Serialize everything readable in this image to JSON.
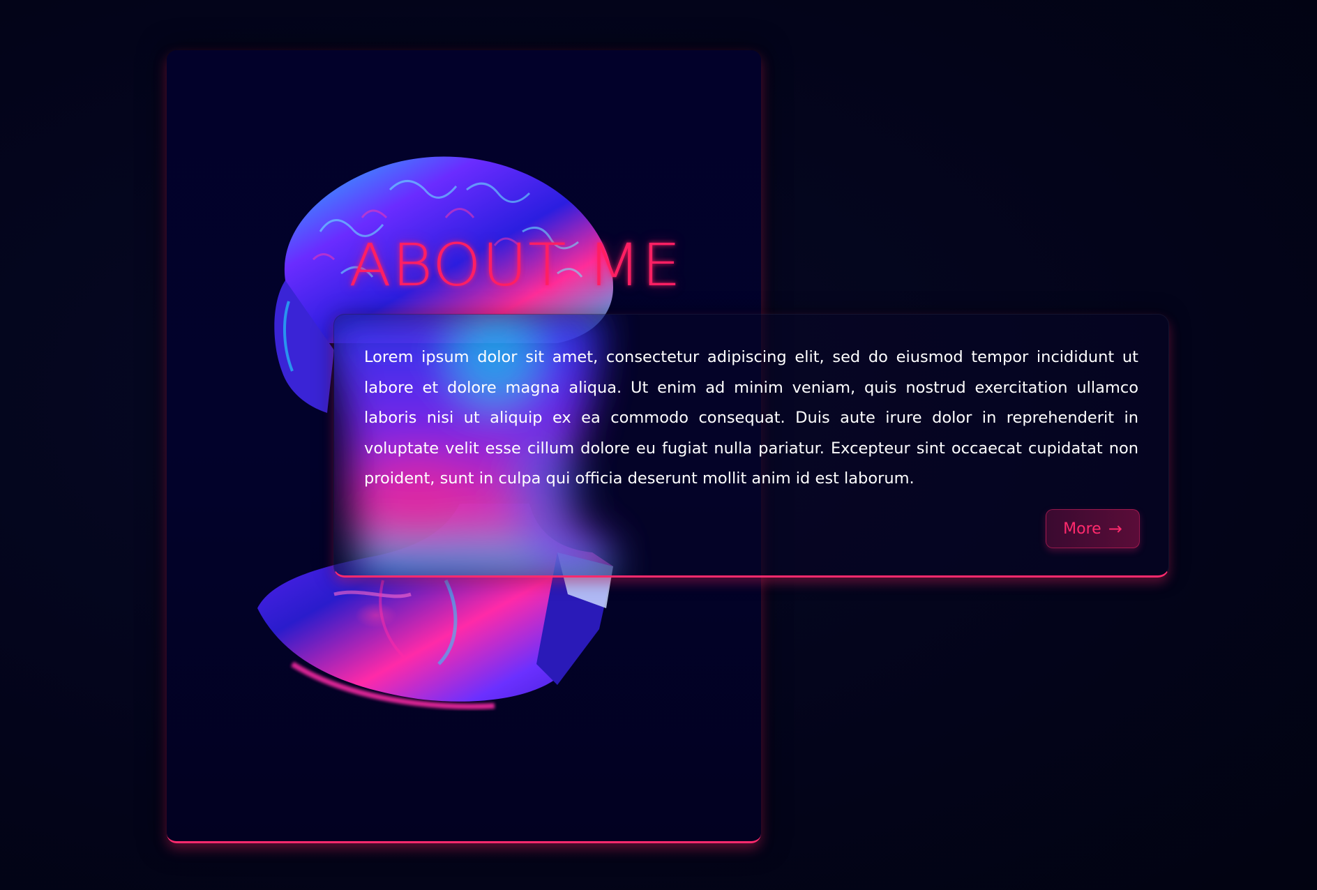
{
  "colors": {
    "background": "#03041a",
    "accent": "#ff2a6d",
    "card": "#02012a",
    "text": "#ffffff"
  },
  "about": {
    "title": "ABOUT ME",
    "body": "Lorem ipsum dolor sit amet, consectetur adipiscing elit, sed do eiusmod tempor incididunt ut labore et dolore magna aliqua. Ut enim ad minim veniam, quis nostrud exercitation ullamco laboris nisi ut aliquip ex ea commodo consequat. Duis aute irure dolor in reprehenderit in voluptate velit esse cillum dolore eu fugiat nulla pariatur. Excepteur sint occaecat cupidatat non proident, sunt in culpa qui officia deserunt mollit anim id est laborum.",
    "more_label": "More",
    "more_icon": "arrow-right-icon",
    "more_arrow": "→"
  },
  "image": {
    "subject": "holographic-bust-image"
  }
}
